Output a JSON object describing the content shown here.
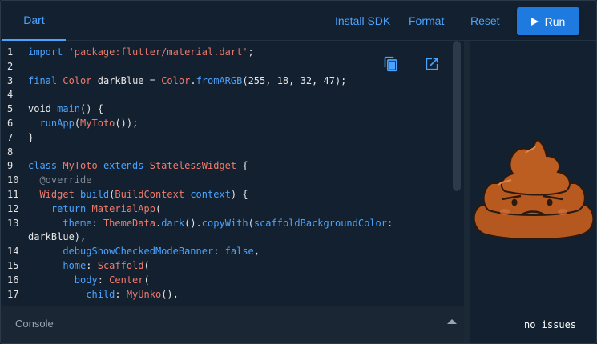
{
  "toolbar": {
    "tab_label": "Dart",
    "install_sdk_label": "Install SDK",
    "format_label": "Format",
    "reset_label": "Reset",
    "run_label": "Run"
  },
  "editor": {
    "copy_icon": "copy-icon",
    "open_icon": "open-in-new-icon",
    "lines": [
      {
        "n": "1",
        "t": [
          [
            "kw",
            "import "
          ],
          [
            "str",
            "'package:flutter/material.dart'"
          ],
          [
            "txt",
            ";"
          ]
        ]
      },
      {
        "n": "2",
        "t": []
      },
      {
        "n": "3",
        "t": [
          [
            "kw",
            "final "
          ],
          [
            "ty",
            "Color "
          ],
          [
            "txt",
            "darkBlue = "
          ],
          [
            "ty",
            "Color"
          ],
          [
            "txt",
            "."
          ],
          [
            "kw",
            "fromARGB"
          ],
          [
            "txt",
            "(255, 18, 32, 47);"
          ]
        ]
      },
      {
        "n": "4",
        "t": []
      },
      {
        "n": "5",
        "t": [
          [
            "txt",
            "void "
          ],
          [
            "kw",
            "main"
          ],
          [
            "txt",
            "() {"
          ]
        ]
      },
      {
        "n": "6",
        "t": [
          [
            "txt",
            "  "
          ],
          [
            "kw",
            "runApp"
          ],
          [
            "txt",
            "("
          ],
          [
            "ty",
            "MyToto"
          ],
          [
            "txt",
            "());"
          ]
        ]
      },
      {
        "n": "7",
        "t": [
          [
            "txt",
            "}"
          ]
        ]
      },
      {
        "n": "8",
        "t": []
      },
      {
        "n": "9",
        "t": [
          [
            "kw",
            "class "
          ],
          [
            "ty",
            "MyToto "
          ],
          [
            "kw",
            "extends "
          ],
          [
            "ty",
            "StatelessWidget "
          ],
          [
            "txt",
            "{"
          ]
        ]
      },
      {
        "n": "10",
        "t": [
          [
            "txt",
            "  "
          ],
          [
            "an",
            "@override"
          ]
        ]
      },
      {
        "n": "11",
        "t": [
          [
            "txt",
            "  "
          ],
          [
            "ty",
            "Widget "
          ],
          [
            "kw",
            "build"
          ],
          [
            "txt",
            "("
          ],
          [
            "ty",
            "BuildContext "
          ],
          [
            "kw",
            "context"
          ],
          [
            "txt",
            ") {"
          ]
        ]
      },
      {
        "n": "12",
        "t": [
          [
            "txt",
            "    "
          ],
          [
            "kw",
            "return "
          ],
          [
            "ty",
            "MaterialApp"
          ],
          [
            "txt",
            "("
          ]
        ]
      },
      {
        "n": "13",
        "t": [
          [
            "txt",
            "      "
          ],
          [
            "kw",
            "theme"
          ],
          [
            "txt",
            ": "
          ],
          [
            "ty",
            "ThemeData"
          ],
          [
            "txt",
            "."
          ],
          [
            "kw",
            "dark"
          ],
          [
            "txt",
            "()."
          ],
          [
            "kw",
            "copyWith"
          ],
          [
            "txt",
            "("
          ],
          [
            "kw",
            "scaffoldBackgroundColor"
          ],
          [
            "txt",
            ":"
          ]
        ]
      },
      {
        "n": "",
        "t": [
          [
            "txt",
            "darkBlue),"
          ]
        ]
      },
      {
        "n": "14",
        "t": [
          [
            "txt",
            "      "
          ],
          [
            "kw",
            "debugShowCheckedModeBanner"
          ],
          [
            "txt",
            ": "
          ],
          [
            "kw",
            "false"
          ],
          [
            "txt",
            ","
          ]
        ]
      },
      {
        "n": "15",
        "t": [
          [
            "txt",
            "      "
          ],
          [
            "kw",
            "home"
          ],
          [
            "txt",
            ": "
          ],
          [
            "ty",
            "Scaffold"
          ],
          [
            "txt",
            "("
          ]
        ]
      },
      {
        "n": "16",
        "t": [
          [
            "txt",
            "        "
          ],
          [
            "kw",
            "body"
          ],
          [
            "txt",
            ": "
          ],
          [
            "ty",
            "Center"
          ],
          [
            "txt",
            "("
          ]
        ]
      },
      {
        "n": "17",
        "t": [
          [
            "txt",
            "          "
          ],
          [
            "kw",
            "child"
          ],
          [
            "txt",
            ": "
          ],
          [
            "ty",
            "MyUnko"
          ],
          [
            "txt",
            "(),"
          ]
        ]
      }
    ]
  },
  "console": {
    "label": "Console"
  },
  "output": {
    "status": "no issues",
    "image_name": "grumpy-poop-illustration"
  }
}
